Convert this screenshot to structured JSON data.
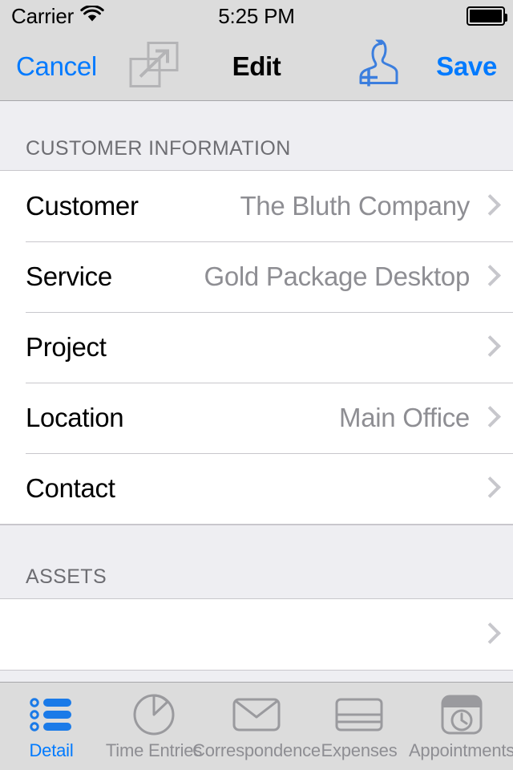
{
  "status_bar": {
    "carrier": "Carrier",
    "time": "5:25 PM",
    "wifi_icon": "wifi-icon",
    "battery_icon": "battery-full-icon"
  },
  "nav_bar": {
    "cancel_label": "Cancel",
    "title": "Edit",
    "save_label": "Save",
    "expand_icon": "expand-duplicate-icon",
    "add_user_icon": "add-person-icon",
    "accent_color": "#007aff"
  },
  "sections": [
    {
      "header": "CUSTOMER INFORMATION",
      "rows": [
        {
          "label": "Customer",
          "value": "The Bluth Company",
          "chevron": "chevron-right-icon"
        },
        {
          "label": "Service",
          "value": "Gold Package Desktop",
          "chevron": "chevron-right-icon"
        },
        {
          "label": "Project",
          "value": "",
          "chevron": "chevron-right-icon"
        },
        {
          "label": "Location",
          "value": "Main Office",
          "chevron": "chevron-right-icon"
        },
        {
          "label": "Contact",
          "value": "",
          "chevron": "chevron-right-icon"
        }
      ]
    },
    {
      "header": "ASSETS",
      "rows": [
        {
          "label": "",
          "value": "",
          "chevron": "chevron-right-icon"
        }
      ]
    }
  ],
  "tab_bar": {
    "active_index": 0,
    "active_color": "#007aff",
    "inactive_color": "#8e8e93",
    "tabs": [
      {
        "label": "Detail",
        "icon": "bulleted-list-icon"
      },
      {
        "label": "Time Entries",
        "icon": "pie-timer-icon"
      },
      {
        "label": "Correspondence",
        "icon": "envelope-icon"
      },
      {
        "label": "Expenses",
        "icon": "credit-card-icon"
      },
      {
        "label": "Appointments",
        "icon": "calendar-clock-icon"
      }
    ]
  }
}
